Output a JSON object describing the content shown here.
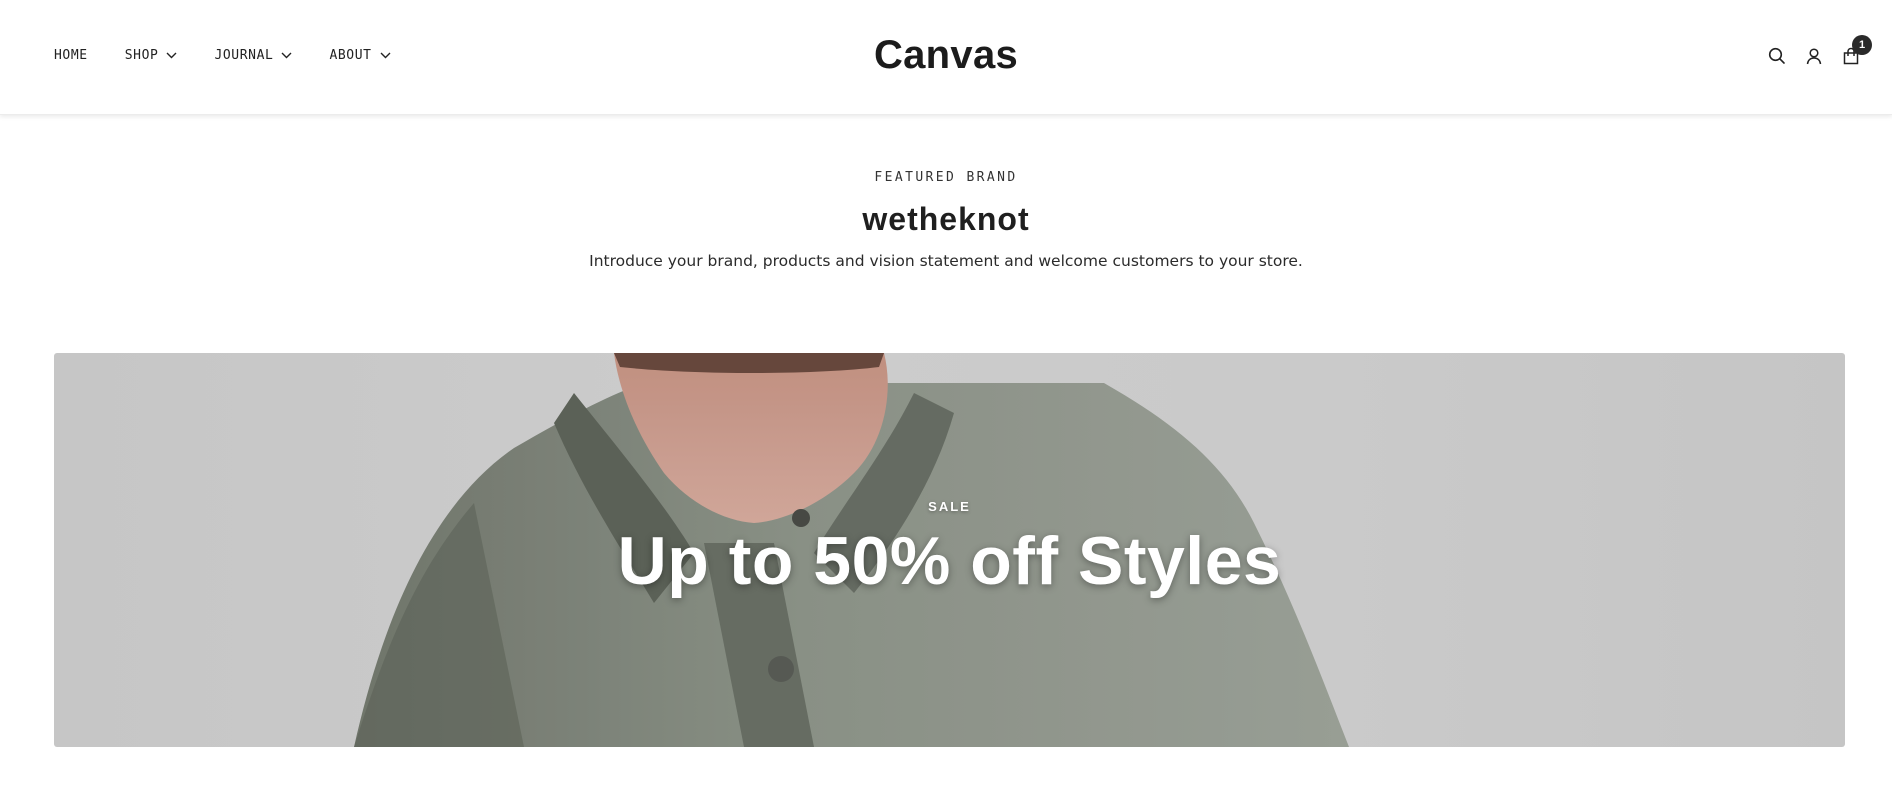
{
  "header": {
    "logo": "Canvas",
    "nav": [
      {
        "label": "HOME",
        "has_dropdown": false
      },
      {
        "label": "SHOP",
        "has_dropdown": true
      },
      {
        "label": "JOURNAL",
        "has_dropdown": true
      },
      {
        "label": "ABOUT",
        "has_dropdown": true
      }
    ],
    "icons": [
      "search-icon",
      "account-icon",
      "cart-icon"
    ],
    "cart_count": "1"
  },
  "featured": {
    "eyebrow": "FEATURED BRAND",
    "brand": "wetheknot",
    "intro": "Introduce your brand, products and vision statement and welcome customers to your store."
  },
  "banner": {
    "kicker": "SALE",
    "title": "Up to 50% off Styles"
  },
  "colors": {
    "text": "#1f1f1f",
    "badge": "#2a2a2a",
    "banner_bg": "#d3d3d3",
    "shirt": "#8e948a"
  }
}
